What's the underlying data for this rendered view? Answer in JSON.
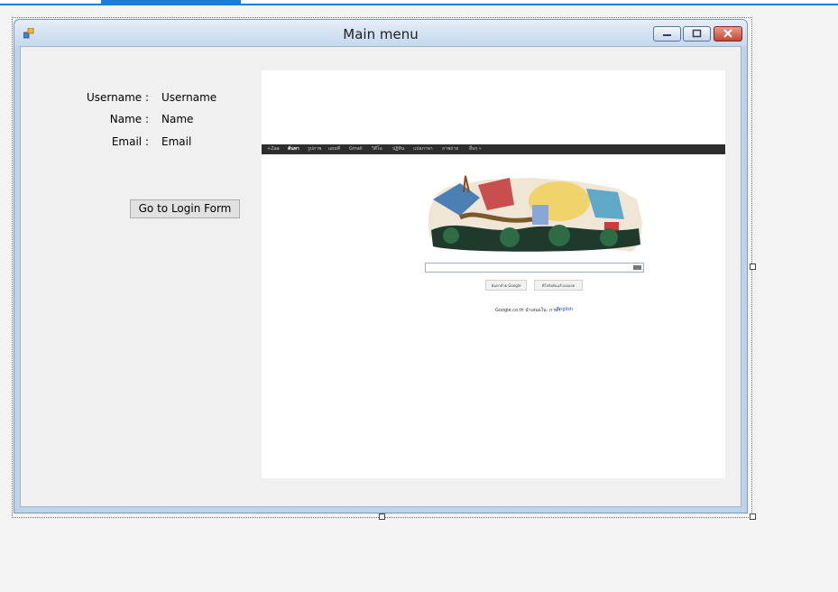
{
  "window": {
    "title": "Main menu"
  },
  "labels": {
    "username_caption": "Username :",
    "username_value": "Username",
    "name_caption": "Name :",
    "name_value": "Name",
    "email_caption": "Email :",
    "email_value": "Email"
  },
  "buttons": {
    "login": "Go to Login Form"
  },
  "browser": {
    "topbar": [
      {
        "text": "+Zaa",
        "active": false
      },
      {
        "text": "ค้นหา",
        "active": true
      },
      {
        "text": "รูปภาพ",
        "active": false
      },
      {
        "text": "แผนที่",
        "active": false
      },
      {
        "text": "Gmail",
        "active": false
      },
      {
        "text": "วิดีโอ",
        "active": false
      },
      {
        "text": "ปฏิทิน",
        "active": false
      },
      {
        "text": "แปลภาษา",
        "active": false
      },
      {
        "text": "ภาพถ่าย",
        "active": false
      },
      {
        "text": "อื่นๆ »",
        "active": false
      }
    ],
    "search_button": "ค้นหาด้วย Google",
    "lucky_button": "ดีใจจังค้นแล้วเจอเลย",
    "footer_text": "Google.co.th นำเสนอใน: ภาษา",
    "footer_link": "English"
  },
  "colors": {
    "accent": "#1c7cd6",
    "titlebar": "#c5d8ee",
    "client": "#f0f0f0",
    "close_button": "#c5452f"
  }
}
